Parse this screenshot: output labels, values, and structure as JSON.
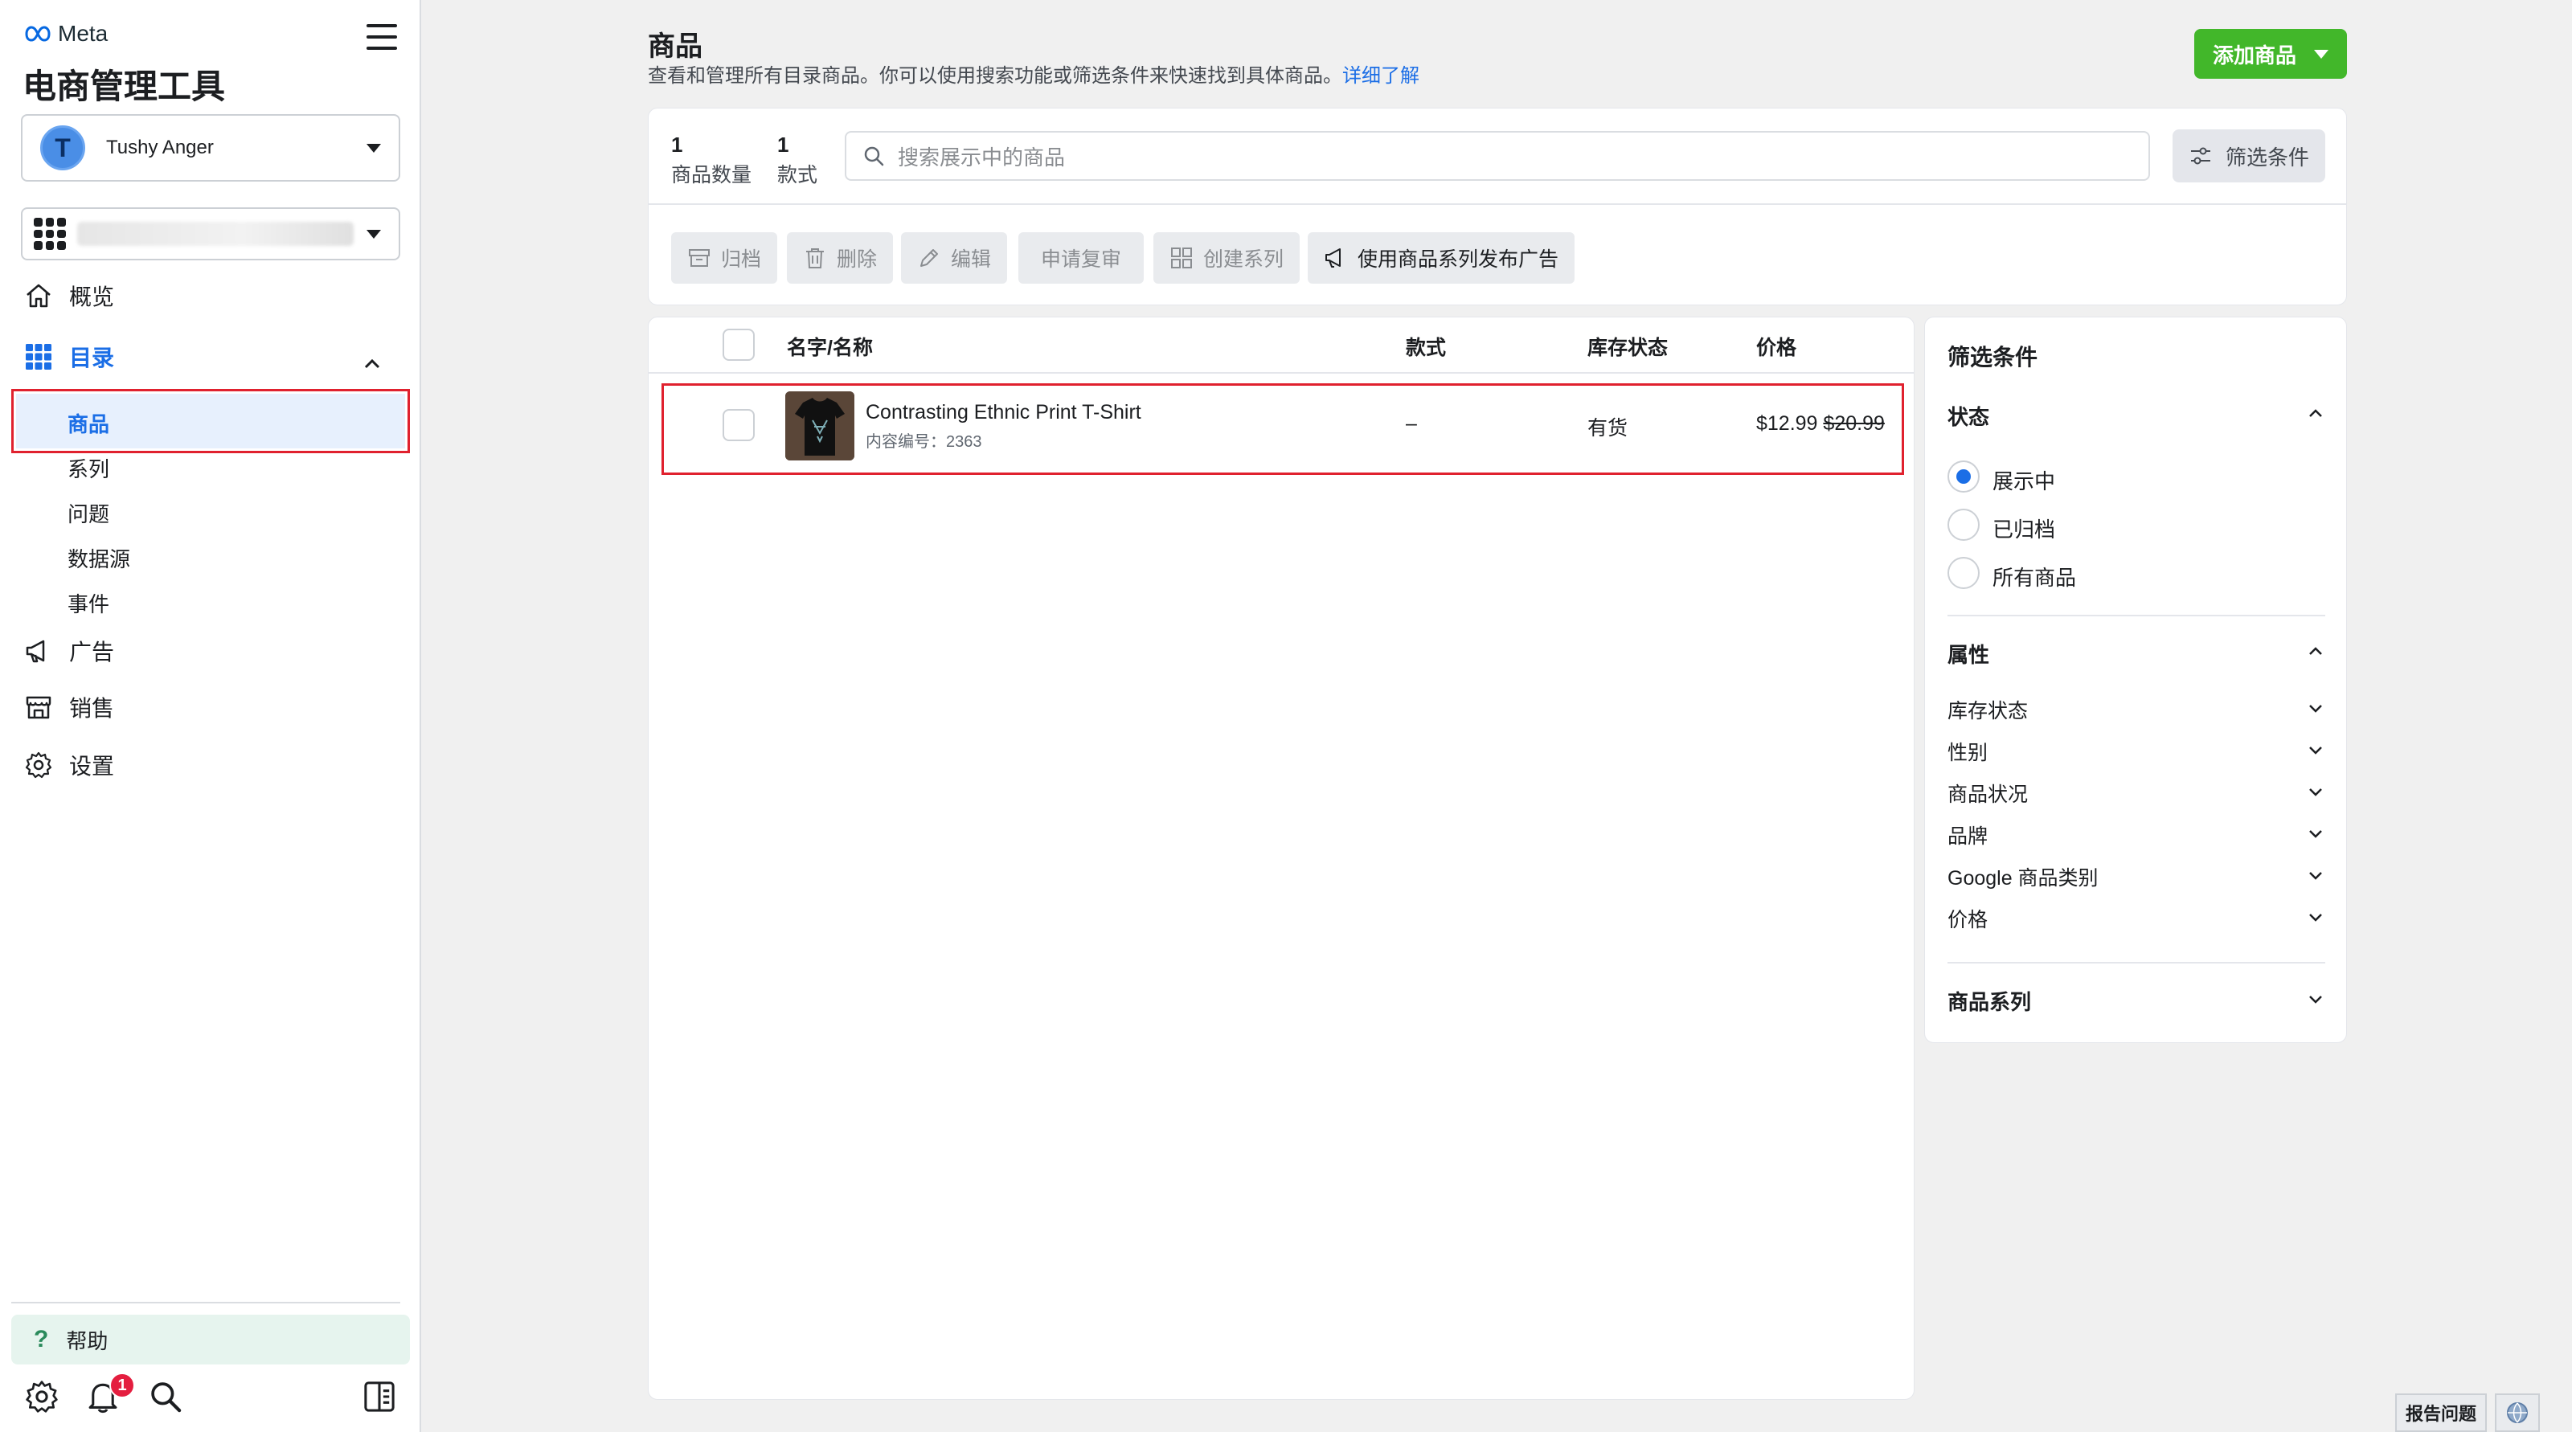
{
  "sidebar": {
    "brand": "Meta",
    "app_title": "电商管理工具",
    "account_initial": "T",
    "account_name": "Tushy Anger",
    "nav": {
      "overview": "概览",
      "catalog": "目录",
      "catalog_items": [
        "商品",
        "系列",
        "问题",
        "数据源",
        "事件"
      ],
      "ads": "广告",
      "sales": "销售",
      "settings": "设置"
    },
    "help": "帮助",
    "notification_count": "1"
  },
  "header": {
    "title": "商品",
    "subtitle": "查看和管理所有目录商品。你可以使用搜索功能或筛选条件来快速找到具体商品。",
    "learn_more": "详细了解",
    "add_button": "添加商品"
  },
  "stats": [
    {
      "num": "1",
      "label": "商品数量"
    },
    {
      "num": "1",
      "label": "款式"
    }
  ],
  "search": {
    "placeholder": "搜索展示中的商品"
  },
  "filter_button": "筛选条件",
  "toolbar": {
    "archive": "归档",
    "delete": "删除",
    "edit": "编辑",
    "request_review": "申请复审",
    "create_set": "创建系列",
    "advertise": "使用商品系列发布广告"
  },
  "table": {
    "headers": {
      "name": "名字/名称",
      "variants": "款式",
      "stock": "库存状态",
      "price": "价格"
    },
    "rows": [
      {
        "name": "Contrasting Ethnic Print T-Shirt",
        "content_id": "内容编号：2363",
        "variants": "–",
        "stock": "有货",
        "price": "$12.99",
        "original_price": "$20.99"
      }
    ]
  },
  "filters": {
    "title": "筛选条件",
    "status_title": "状态",
    "status_options": [
      "展示中",
      "已归档",
      "所有商品"
    ],
    "status_selected": "展示中",
    "attributes_title": "属性",
    "attributes": [
      "库存状态",
      "性别",
      "商品状况",
      "品牌",
      "Google 商品类别",
      "价格"
    ],
    "sets_title": "商品系列"
  },
  "footer": {
    "report": "报告问题"
  },
  "colors": {
    "accent": "#1b6ee6",
    "add_button": "#42b72a",
    "highlight_border": "#e0212e"
  }
}
